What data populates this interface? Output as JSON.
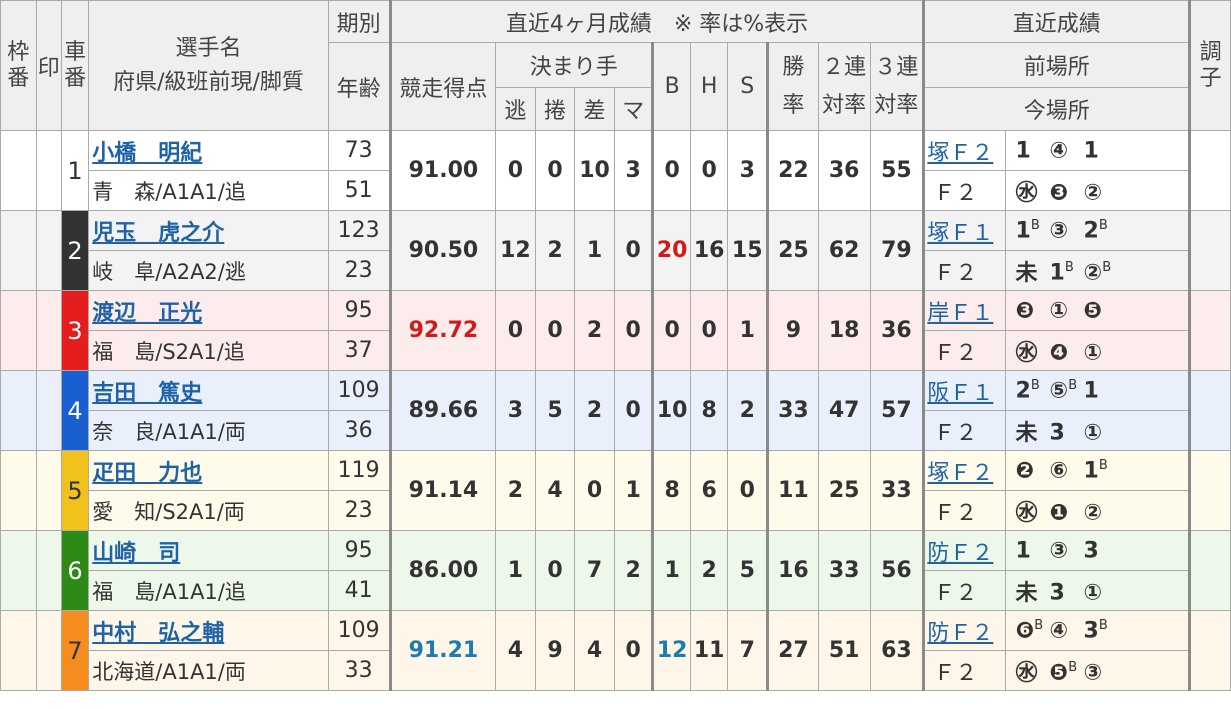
{
  "header": {
    "waku": "枠番",
    "shirushi": "印",
    "shaban": "車番",
    "name_line1": "選手名",
    "name_line2": "府県/級班前現/脚質",
    "kibetsu": "期別",
    "nenrei": "年齢",
    "recent4": "直近4ヶ月成績　※ 率は%表示",
    "score": "競走得点",
    "kimarite": "決まり手",
    "nige": "逃",
    "makuri": "捲",
    "sashi": "差",
    "mark": "マ",
    "b": "B",
    "h": "H",
    "s": "S",
    "win_rate_1": "勝",
    "win_rate_2": "率",
    "ren2_1": "２連",
    "ren2_2": "対率",
    "ren3_1": "３連",
    "ren3_2": "対率",
    "recent_results": "直近成績",
    "prev_track": "前場所",
    "cur_track": "今場所",
    "condition": "調子"
  },
  "riders": [
    {
      "num": "1",
      "name": "小橋　明紀",
      "pref": "青　森/A1A1/追",
      "period": "73",
      "age": "51",
      "score": "91.00",
      "nige": "0",
      "makuri": "0",
      "sashi": "10",
      "mark": "3",
      "b": "0",
      "h": "0",
      "s": "3",
      "win": "22",
      "ren2": "36",
      "ren3": "55",
      "prev_track": "塚Ｆ２",
      "prev_results": [
        "1",
        "④",
        "1"
      ],
      "prev_sups": [
        "",
        "",
        ""
      ],
      "cur_track": "Ｆ２",
      "cur_results": [
        "㊌",
        "❸",
        "②"
      ],
      "cur_sups": [
        "",
        "",
        ""
      ]
    },
    {
      "num": "2",
      "name": "児玉　虎之介",
      "pref": "岐　阜/A2A2/逃",
      "period": "123",
      "age": "23",
      "score": "90.50",
      "nige": "12",
      "makuri": "2",
      "sashi": "1",
      "mark": "0",
      "b": "20",
      "h": "16",
      "s": "15",
      "win": "25",
      "ren2": "62",
      "ren3": "79",
      "prev_track": "塚Ｆ１",
      "prev_results": [
        "1",
        "③",
        "2"
      ],
      "prev_sups": [
        "B",
        "",
        "B"
      ],
      "cur_track": "Ｆ２",
      "cur_results": [
        "未",
        "1",
        "②"
      ],
      "cur_sups": [
        "",
        "B",
        "B"
      ]
    },
    {
      "num": "3",
      "name": "渡辺　正光",
      "pref": "福　島/S2A1/追",
      "period": "95",
      "age": "37",
      "score": "92.72",
      "nige": "0",
      "makuri": "0",
      "sashi": "2",
      "mark": "0",
      "b": "0",
      "h": "0",
      "s": "1",
      "win": "9",
      "ren2": "18",
      "ren3": "36",
      "prev_track": "岸Ｆ１",
      "prev_results": [
        "❸",
        "①",
        "❺"
      ],
      "prev_sups": [
        "",
        "",
        ""
      ],
      "cur_track": "Ｆ２",
      "cur_results": [
        "㊌",
        "❹",
        "①"
      ],
      "cur_sups": [
        "",
        "",
        ""
      ]
    },
    {
      "num": "4",
      "name": "吉田　篤史",
      "pref": "奈　良/A1A1/両",
      "period": "109",
      "age": "36",
      "score": "89.66",
      "nige": "3",
      "makuri": "5",
      "sashi": "2",
      "mark": "0",
      "b": "10",
      "h": "8",
      "s": "2",
      "win": "33",
      "ren2": "47",
      "ren3": "57",
      "prev_track": "阪Ｆ１",
      "prev_results": [
        "2",
        "⑤",
        "1"
      ],
      "prev_sups": [
        "B",
        "B",
        ""
      ],
      "cur_track": "Ｆ２",
      "cur_results": [
        "未",
        "3",
        "①"
      ],
      "cur_sups": [
        "",
        "",
        ""
      ]
    },
    {
      "num": "5",
      "name": "疋田　力也",
      "pref": "愛　知/S2A1/両",
      "period": "119",
      "age": "23",
      "score": "91.14",
      "nige": "2",
      "makuri": "4",
      "sashi": "0",
      "mark": "1",
      "b": "8",
      "h": "6",
      "s": "0",
      "win": "11",
      "ren2": "25",
      "ren3": "33",
      "prev_track": "塚Ｆ２",
      "prev_results": [
        "❷",
        "⑥",
        "1"
      ],
      "prev_sups": [
        "",
        "",
        "B"
      ],
      "cur_track": "Ｆ２",
      "cur_results": [
        "㊌",
        "❶",
        "②"
      ],
      "cur_sups": [
        "",
        "",
        ""
      ]
    },
    {
      "num": "6",
      "name": "山崎　司",
      "pref": "福　島/A1A1/追",
      "period": "95",
      "age": "41",
      "score": "86.00",
      "nige": "1",
      "makuri": "0",
      "sashi": "7",
      "mark": "2",
      "b": "1",
      "h": "2",
      "s": "5",
      "win": "16",
      "ren2": "33",
      "ren3": "56",
      "prev_track": "防Ｆ２",
      "prev_results": [
        "1",
        "③",
        "3"
      ],
      "prev_sups": [
        "",
        "",
        ""
      ],
      "cur_track": "Ｆ２",
      "cur_results": [
        "未",
        "3",
        "①"
      ],
      "cur_sups": [
        "",
        "",
        ""
      ]
    },
    {
      "num": "7",
      "name": "中村　弘之輔",
      "pref": "北海道/A1A1/両",
      "period": "109",
      "age": "33",
      "score": "91.21",
      "nige": "4",
      "makuri": "9",
      "sashi": "4",
      "mark": "0",
      "b": "12",
      "h": "11",
      "s": "7",
      "win": "27",
      "ren2": "51",
      "ren3": "63",
      "prev_track": "防Ｆ２",
      "prev_results": [
        "❻",
        "④",
        "3"
      ],
      "prev_sups": [
        "B",
        "",
        "B"
      ],
      "cur_track": "Ｆ２",
      "cur_results": [
        "㊌",
        "❺",
        "③"
      ],
      "cur_sups": [
        "",
        "B",
        ""
      ]
    }
  ],
  "highlights": {
    "red_color": "#d31a1a",
    "blue_color": "#1b7bb3",
    "top_score_rider": "3",
    "high_score_rider": "7",
    "top_b_rider": "2",
    "high_b_rider": "7"
  }
}
